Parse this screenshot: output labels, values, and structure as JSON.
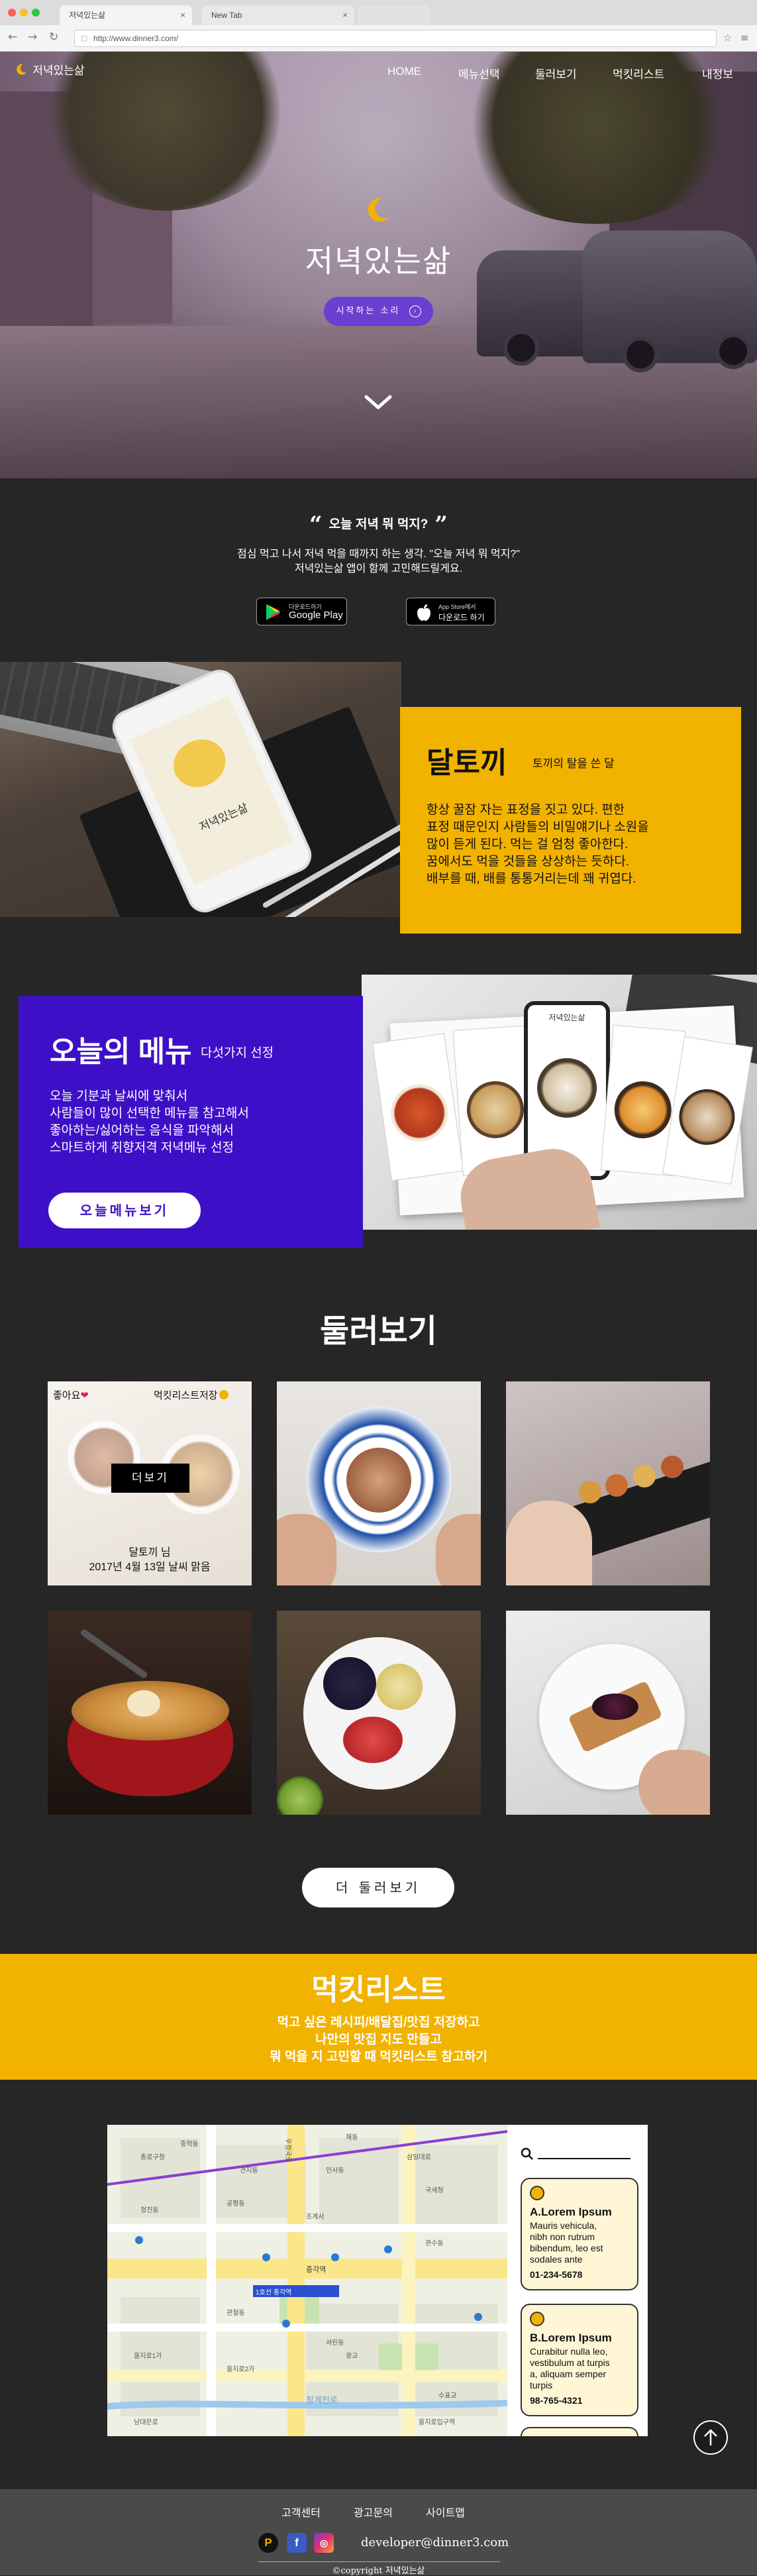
{
  "browser": {
    "tabs": [
      {
        "label": "저녁있는삶",
        "active": true
      },
      {
        "label": "New Tab",
        "active": false
      }
    ],
    "url": "http://www.dinner3.com/"
  },
  "header": {
    "logo_text": "저녁있는삶",
    "nav": [
      "HOME",
      "메뉴선택",
      "둘러보기",
      "먹킷리스트",
      "내정보"
    ]
  },
  "hero": {
    "title": "저녁있는삶",
    "button_label": "시작하는 소리",
    "icons": [
      "moon-icon",
      "chevron-down-icon",
      "arrow-right-icon"
    ]
  },
  "intro": {
    "quote": "오늘 저녁 뭐 먹지?",
    "line1": "점심 먹고 나서 저녁 먹을 때까지 하는 생각. \"오늘 저녁 뭐 먹지?\"",
    "line2": "저녁있는삶 앱이 함께 고민해드릴게요.",
    "google": {
      "small": "다운로드하기",
      "big": "Google Play"
    },
    "apple": {
      "small": "App Store에서",
      "big": "다운로드 하기"
    }
  },
  "daltokki": {
    "title": "달토끼",
    "subtitle": "토끼의 탈을 쓴 달",
    "lines": [
      "항상 꿀잠 자는 표정을 짓고 있다. 편한",
      "표정 때문인지 사람들의 비밀얘기나 소원을",
      "많이 듣게 된다. 먹는 걸 엄청 좋아한다.",
      "꿈에서도 먹을 것들을 상상하는 듯하다.",
      "배부를 때, 배를 통통거리는데 꽤 귀엽다."
    ],
    "phone_screen_text": "저녁있는삶"
  },
  "today_menu": {
    "title": "오늘의 메뉴",
    "subtitle": "다섯가지 선정",
    "lines": [
      "오늘 기분과 날씨에 맞춰서",
      "사람들이 많이 선택한 메뉴를 참고해서",
      "좋아하는/싫어하는 음식을 파악해서",
      "스마트하게 취향저격 저녁메뉴 선정"
    ],
    "button_label": "오늘메뉴보기",
    "phone_screen_text": "저녁있는삶"
  },
  "gallery": {
    "title": "둘러보기",
    "first_card": {
      "like": "좋아요",
      "save": "먹킷리스트저장",
      "more": "더보기",
      "user": "달토끼 님",
      "date": "2017년 4월 13일 날씨 맑음"
    },
    "items": [
      "pasta-plate",
      "pastry-board",
      "hands-board",
      "ramen-bowl",
      "fruit-bowl",
      "toast-plate"
    ],
    "more_button": "더 둘러보기"
  },
  "mukit": {
    "title": "먹킷리스트",
    "lines": [
      "먹고 싶은 레시피/배달집/맛집 저장하고",
      "나만의 맛집 지도 만들고",
      "뭐 먹을 지 고민할 때 먹킷리스트 참고하기"
    ]
  },
  "map": {
    "labels": [
      "1호선 종각역",
      "종각역",
      "조계사",
      "광교",
      "수표교",
      "청계천로",
      "우정국로",
      "삼일대로",
      "공평동",
      "관철동",
      "서린동",
      "을지로입구역",
      "종로구청",
      "청진동",
      "인사동",
      "견지동",
      "국세청",
      "재동",
      "중학동",
      "관수동",
      "을지로1가",
      "을지로2가",
      "남대문로"
    ],
    "cards": [
      {
        "title": "A.Lorem Ipsum",
        "lines": [
          "Mauris vehicula,",
          "nibh non rutrum",
          "bibendum, leo est",
          "sodales ante"
        ],
        "phone": "01-234-5678"
      },
      {
        "title": "B.Lorem Ipsum",
        "lines": [
          "Curabitur nulla leo,",
          "vestibulum at turpis",
          "a, aliquam semper",
          "turpis"
        ],
        "phone": "98-765-4321"
      }
    ]
  },
  "footer": {
    "links": [
      "고객센터",
      "광고문의",
      "사이트맵"
    ],
    "email": "developer@dinner3.com",
    "copyright": "©copyright 저녁있는삶"
  },
  "colors": {
    "accent_yellow": "#f2b200",
    "accent_purple": "#3d10c8",
    "hero_button": "#6b3fd0",
    "dark_bg": "#262626",
    "footer_bg": "#4a4a4a"
  }
}
